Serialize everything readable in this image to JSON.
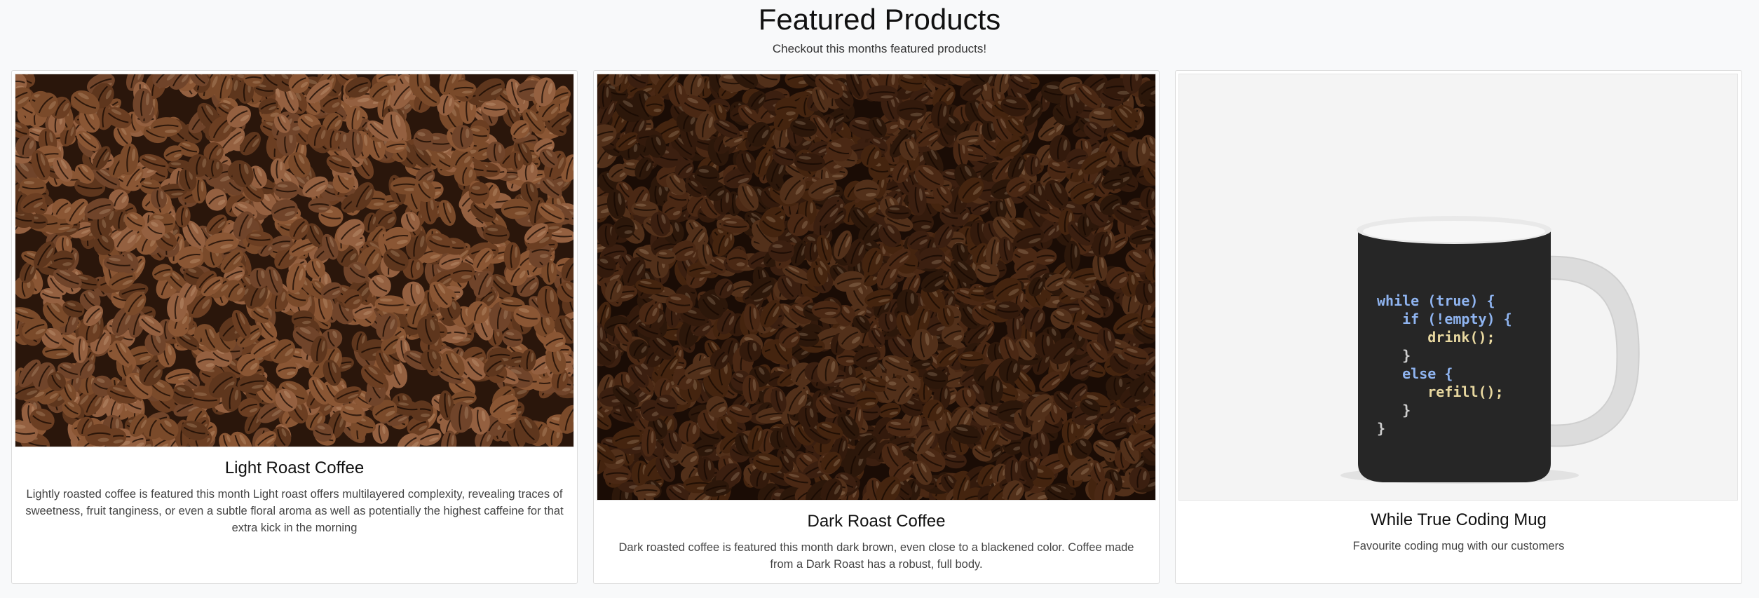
{
  "section": {
    "title": "Featured Products",
    "subtitle": "Checkout this months featured products!"
  },
  "products": [
    {
      "name": "Light Roast Coffee",
      "description": "Lightly roasted coffee is featured this month Light roast offers multilayered complexity, revealing traces of sweetness, fruit tanginess, or even a subtle floral aroma as well as potentially the highest caffeine for that extra kick in the morning",
      "image_icon": "coffee-beans-light-image"
    },
    {
      "name": "Dark Roast Coffee",
      "description": "Dark roasted coffee is featured this month dark brown, even close to a blackened color. Coffee made from a Dark Roast has a robust, full body.",
      "image_icon": "coffee-beans-dark-image"
    },
    {
      "name": "While True Coding Mug",
      "description": "Favourite coding mug with our customers",
      "image_icon": "coding-mug-image",
      "mug_code": [
        "while (true) {",
        "   if (!empty) {",
        "      drink();",
        "   }",
        "   else {",
        "      refill();",
        "   }",
        "}"
      ]
    }
  ],
  "colors": {
    "page_background": "#f8f9fa",
    "card_border": "#dcdcdc",
    "light_roast_bean": "#6b3e22",
    "dark_roast_bean": "#3b1f10",
    "mug_body": "#262626",
    "code_keyword": "#8fb4f0",
    "code_function": "#e8d8a0"
  }
}
